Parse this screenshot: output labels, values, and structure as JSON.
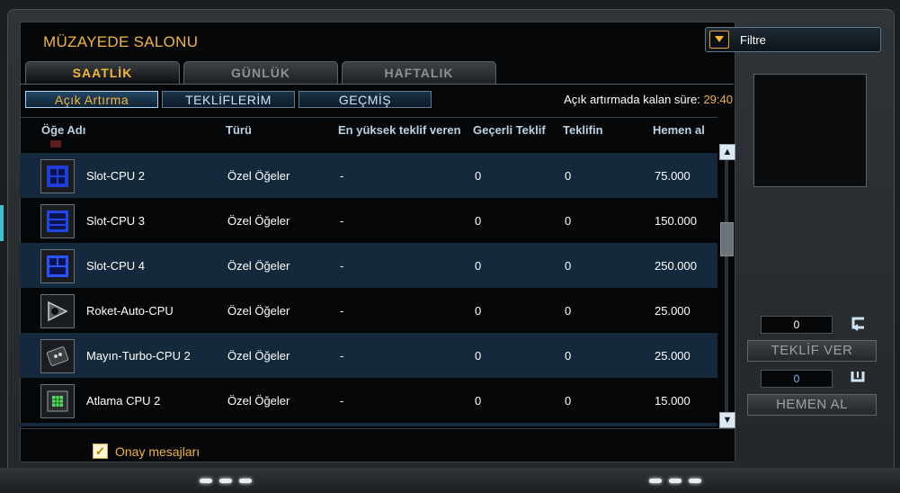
{
  "window": {
    "title": "MÜZAYEDE SALONU"
  },
  "tabs": [
    {
      "label": "SAATLİK",
      "active": true
    },
    {
      "label": "GÜNLÜK",
      "active": false
    },
    {
      "label": "HAFTALIK",
      "active": false
    }
  ],
  "subtabs": [
    {
      "label": "Açık Artırma",
      "active": true
    },
    {
      "label": "TEKLİFLERİM",
      "active": false
    },
    {
      "label": "GEÇMİŞ",
      "active": false
    }
  ],
  "timer": {
    "label": "Açık artırmada kalan süre:",
    "value": "29:40"
  },
  "columns": {
    "name": "Öğe Adı",
    "type": "Türü",
    "top_bidder": "En yüksek teklif veren",
    "current_bid": "Geçerli Teklif",
    "your_bid": "Teklifin",
    "buyout": "Hemen al"
  },
  "rows": [
    {
      "name": "Slot-CPU 2",
      "type": "Özel Öğeler",
      "top_bidder": "-",
      "current_bid": "0",
      "your_bid": "0",
      "buyout": "75.000",
      "icon": "slot-cpu-chip-icon"
    },
    {
      "name": "Slot-CPU 3",
      "type": "Özel Öğeler",
      "top_bidder": "-",
      "current_bid": "0",
      "your_bid": "0",
      "buyout": "150.000",
      "icon": "slot-cpu-chip-icon"
    },
    {
      "name": "Slot-CPU 4",
      "type": "Özel Öğeler",
      "top_bidder": "-",
      "current_bid": "0",
      "your_bid": "0",
      "buyout": "250.000",
      "icon": "slot-cpu-chip-icon"
    },
    {
      "name": "Roket-Auto-CPU",
      "type": "Özel Öğeler",
      "top_bidder": "-",
      "current_bid": "0",
      "your_bid": "0",
      "buyout": "25.000",
      "icon": "rocket-cpu-icon"
    },
    {
      "name": "Mayın-Turbo-CPU 2",
      "type": "Özel Öğeler",
      "top_bidder": "-",
      "current_bid": "0",
      "your_bid": "0",
      "buyout": "25.000",
      "icon": "mine-cpu-icon"
    },
    {
      "name": "Atlama CPU 2",
      "type": "Özel Öğeler",
      "top_bidder": "-",
      "current_bid": "0",
      "your_bid": "0",
      "buyout": "15.000",
      "icon": "jump-cpu-icon"
    }
  ],
  "filter": {
    "label": "Filtre",
    "icon": "filter-dropdown-icon"
  },
  "bid": {
    "value": "0",
    "button": "TEKLİF VER"
  },
  "buyout_panel": {
    "value": "0",
    "button": "HEMEN AL"
  },
  "confirm": {
    "label": "Onay mesajları",
    "checked": true
  },
  "colors": {
    "accent": "#f2b53d",
    "row_alt": "#142a3c",
    "header_text": "#bcd3e6"
  }
}
